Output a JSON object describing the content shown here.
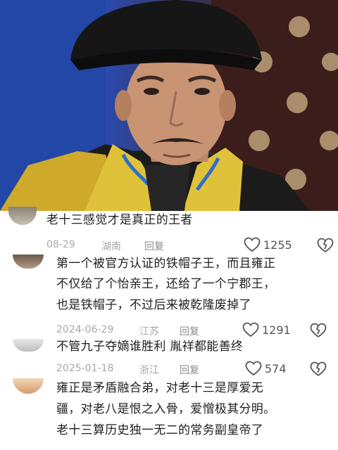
{
  "comments": [
    {
      "text_lines": [
        "老十三感觉才是真正的王者"
      ],
      "date": "08-29",
      "location": "湖南",
      "reply_label": "回复",
      "likes": "1255"
    },
    {
      "text_lines": [
        "第一个被官方认证的铁帽子王，而且雍正",
        "不仅给了个怡亲王，还给了一个宁郡王，",
        "也是铁帽子，不过后来被乾隆废掉了"
      ],
      "date": "2024-06-29",
      "location": "江苏",
      "reply_label": "回复",
      "likes": "1291"
    },
    {
      "text_lines": [
        "不管九子夺嫡谁胜利 胤祥都能善终"
      ],
      "date": "2025-01-18",
      "location": "浙江",
      "reply_label": "回复",
      "likes": "574"
    },
    {
      "text_lines": [
        "雍正是矛盾融合弟，对老十三是厚爱无",
        "疆，对老八是恨之入骨，爱憎极其分明。",
        "老十三算历史独一无二的常务副皇帝了"
      ]
    }
  ],
  "icons": {
    "like": "heart-icon",
    "dislike": "broken-heart-icon"
  },
  "colors": {
    "text": "#1f1f1f",
    "meta": "#a8a8a8",
    "icon": "#555555"
  }
}
